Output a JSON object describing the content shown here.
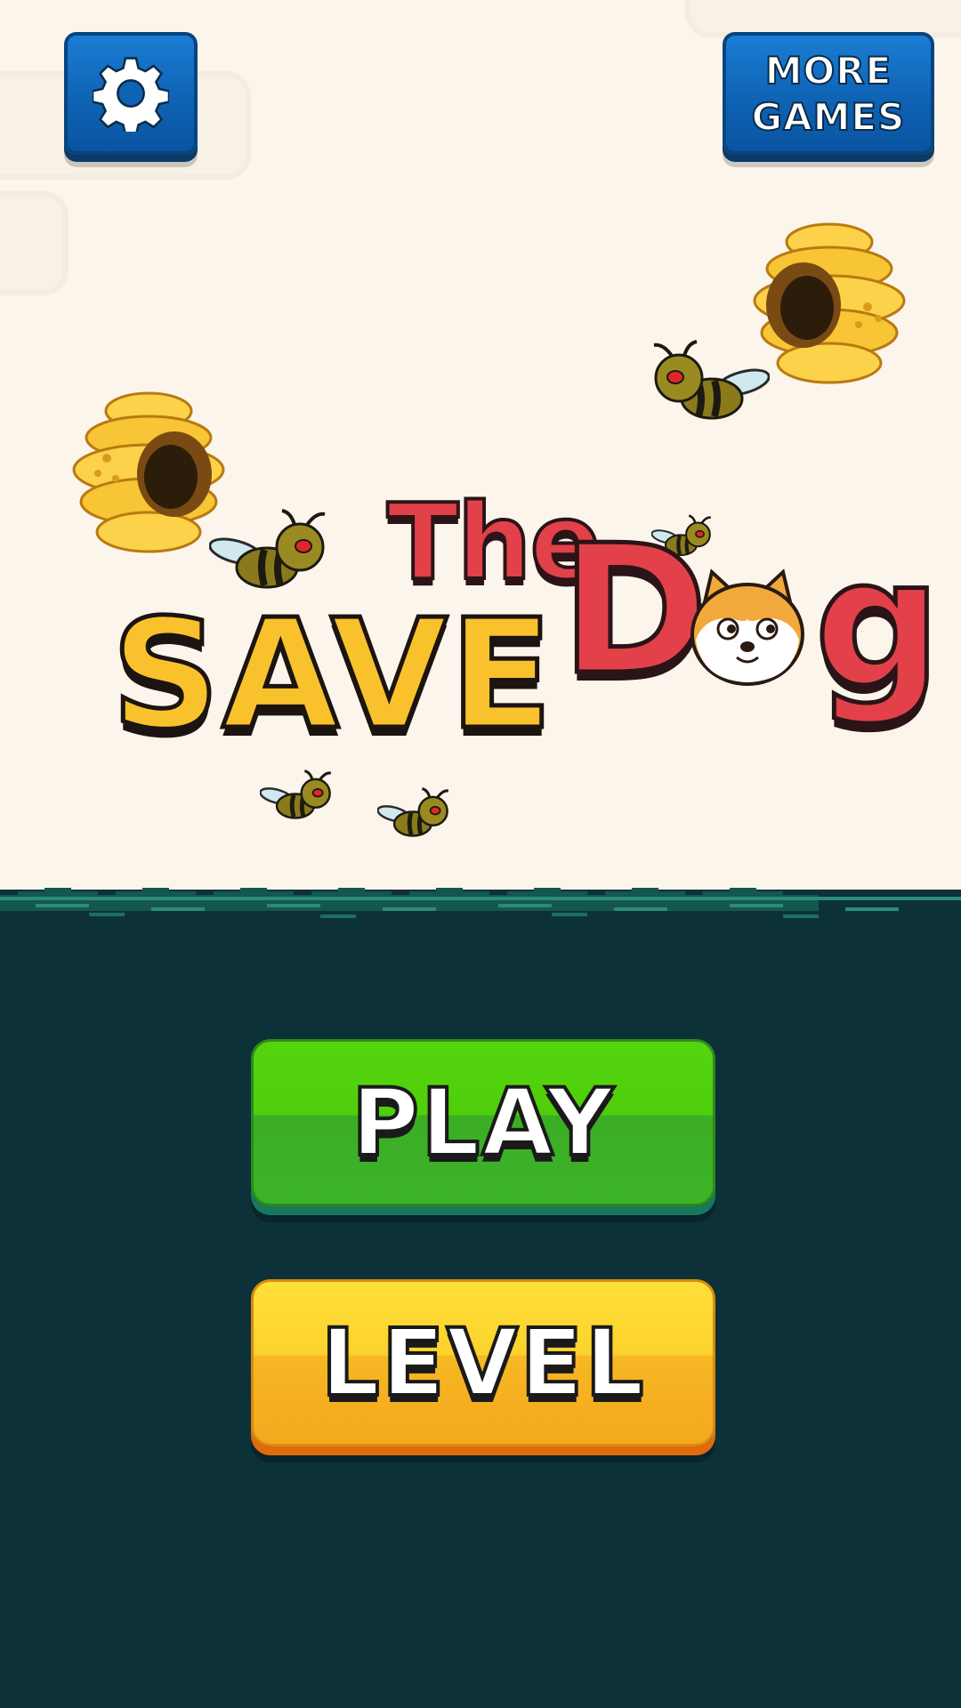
{
  "header": {
    "settings_icon": "gear-icon",
    "more_games_label_line1": "MORE",
    "more_games_label_line2": "GAMES"
  },
  "title": {
    "word_save": "SAVE",
    "word_the": "The",
    "word_dog_first": "D",
    "word_dog_last": "g",
    "dog_face_icon": "doge-face-icon"
  },
  "decor": {
    "beehive_icon": "beehive-icon",
    "bee_icon": "bee-icon"
  },
  "menu": {
    "play_label": "PLAY",
    "level_label": "LEVEL"
  },
  "colors": {
    "sky": "#fbf5ec",
    "ground": "#0c3139",
    "wave_light": "#2b8a78",
    "wave_dark": "#14574f",
    "blue_button": "#0f63b5",
    "play_green": "#4fcf0b",
    "level_yellow": "#fcd22c",
    "title_red": "#e2414a",
    "title_yellow": "#f9c22d"
  }
}
